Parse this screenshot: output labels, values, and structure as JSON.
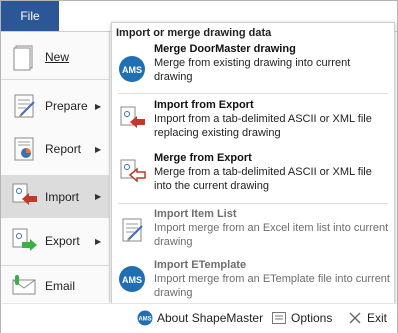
{
  "file_tab": "File",
  "left_menu": [
    {
      "label": "New",
      "icon": "new-drawing-icon",
      "has_arrow": false
    },
    {
      "label": "Prepare",
      "icon": "prepare-icon",
      "has_arrow": true
    },
    {
      "label": "Report",
      "icon": "report-icon",
      "has_arrow": true
    },
    {
      "label": "Import",
      "icon": "import-icon",
      "has_arrow": true,
      "selected": true
    },
    {
      "label": "Export",
      "icon": "export-icon",
      "has_arrow": true
    },
    {
      "label": "Email",
      "icon": "email-icon",
      "has_arrow": false
    }
  ],
  "submenu": {
    "header": "Import or merge drawing data",
    "items": [
      {
        "title": "Merge DoorMaster drawing",
        "desc": "Merge from existing drawing into current drawing",
        "icon": "ams-logo-icon",
        "enabled": true
      },
      {
        "title": "Import from Export",
        "desc": "Import from a tab-delimited ASCII or XML file replacing existing drawing",
        "icon": "import-from-export-icon",
        "enabled": true
      },
      {
        "title": "Merge from Export",
        "desc": "Merge from a tab-delimited ASCII or XML file into the current drawing",
        "icon": "merge-from-export-icon",
        "enabled": true
      },
      {
        "title": "Import Item List",
        "desc": "Import merge from an Excel item list into current drawing",
        "icon": "item-list-icon",
        "enabled": false
      },
      {
        "title": "Import ETemplate",
        "desc": "Import merge from an ETemplate file into current drawing",
        "icon": "ams-logo-icon",
        "enabled": false
      }
    ]
  },
  "bottom": {
    "about": "About ShapeMaster",
    "options": "Options",
    "exit": "Exit"
  },
  "colors": {
    "file_tab_bg": "#2b5797",
    "import_arrow": "#c0392b",
    "export_arrow": "#3cb043",
    "ams_blue": "#1f6fb2"
  }
}
